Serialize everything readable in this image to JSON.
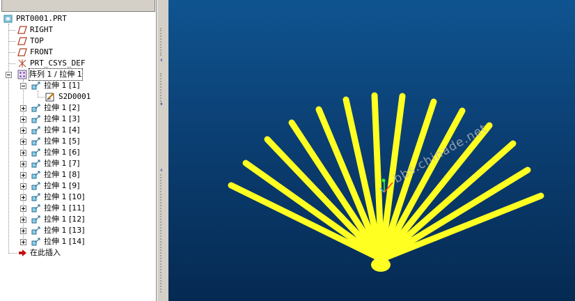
{
  "model_tree": {
    "root": "PRT0001.PRT",
    "items": [
      {
        "label": "RIGHT",
        "icon": "datum-plane-icon"
      },
      {
        "label": "TOP",
        "icon": "datum-plane-icon"
      },
      {
        "label": "FRONT",
        "icon": "datum-plane-icon"
      },
      {
        "label": "PRT_CSYS_DEF",
        "icon": "coordinate-system-icon"
      },
      {
        "label": "阵列 1 / 拉伸 1",
        "icon": "pattern-icon"
      }
    ],
    "pattern_members": [
      {
        "label": "拉伸 1 [1]",
        "expanded": true
      },
      {
        "label": "拉伸 1 [2]"
      },
      {
        "label": "拉伸 1 [3]"
      },
      {
        "label": "拉伸 1 [4]"
      },
      {
        "label": "拉伸 1 [5]"
      },
      {
        "label": "拉伸 1 [6]"
      },
      {
        "label": "拉伸 1 [7]"
      },
      {
        "label": "拉伸 1 [8]"
      },
      {
        "label": "拉伸 1 [9]"
      },
      {
        "label": "拉伸 1 [10]"
      },
      {
        "label": "拉伸 1 [11]"
      },
      {
        "label": "拉伸 1 [12]"
      },
      {
        "label": "拉伸 1 [13]"
      },
      {
        "label": "拉伸 1 [14]"
      }
    ],
    "sketch_label": "S2D0001",
    "insert_here": "在此插入"
  },
  "viewport": {
    "watermark": "bbs.chinade.net",
    "model_color": "#ffff22",
    "background_top": "#0f5490",
    "background_bottom": "#052a52"
  }
}
